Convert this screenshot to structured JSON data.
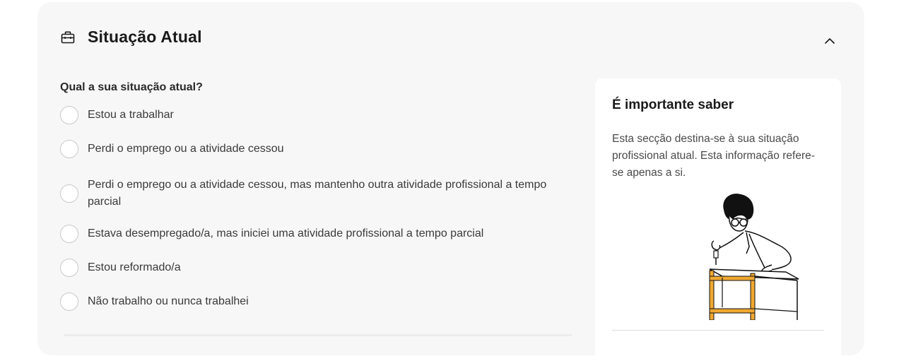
{
  "section": {
    "title": "Situação Atual",
    "icon": "briefcase-icon",
    "collapse_icon": "chevron-up-icon"
  },
  "question": {
    "label": "Qual a sua situação atual?",
    "options": [
      {
        "label": "Estou a trabalhar",
        "selected": false
      },
      {
        "label": "Perdi o emprego ou a atividade cessou",
        "selected": false
      },
      {
        "label": "Perdi o emprego ou a atividade cessou, mas mantenho outra atividade profissional a tempo parcial",
        "selected": false
      },
      {
        "label": "Estava desempregado/a, mas iniciei uma atividade profissional a tempo parcial",
        "selected": false
      },
      {
        "label": "Estou reformado/a",
        "selected": false
      },
      {
        "label": "Não trabalho ou nunca trabalhei",
        "selected": false
      }
    ]
  },
  "info": {
    "title": "É importante saber",
    "text": "Esta secção destina-se à sua situação profissional atual. Esta informação refere-se apenas a si.",
    "illustration": "person-assembling-furniture-illustration"
  },
  "colors": {
    "card_bg": "#f7f7f7",
    "panel_bg": "#ffffff",
    "accent": "#f0a830"
  }
}
